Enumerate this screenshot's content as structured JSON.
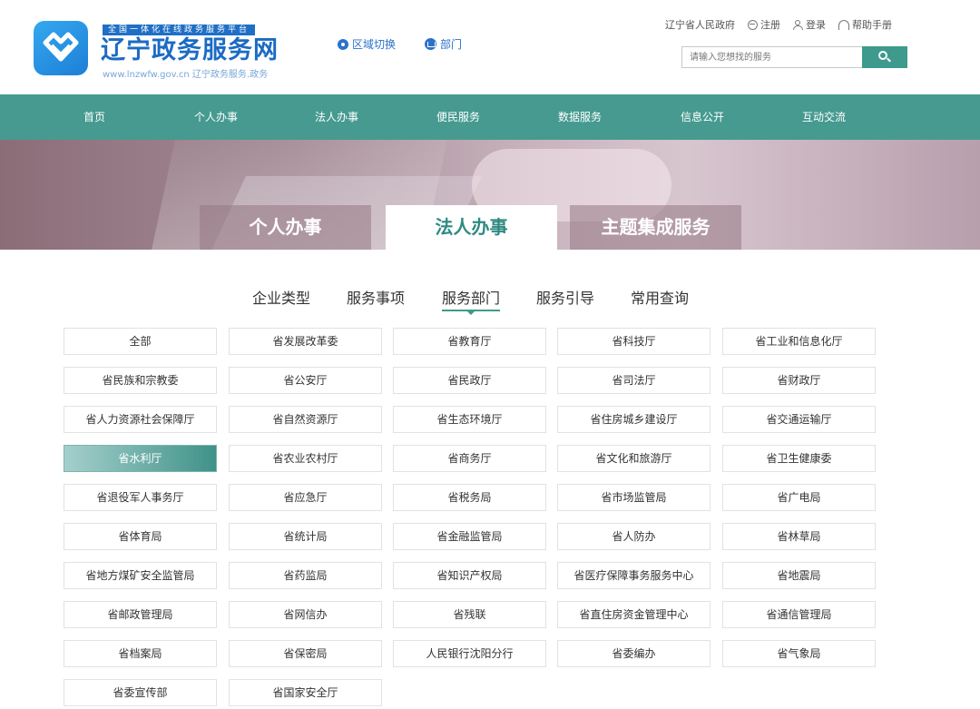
{
  "header": {
    "logo_band": "全国一体化在线政务服务平台",
    "logo_title": "辽宁政务服务网",
    "logo_url": "www.lnzwfw.gov.cn 辽宁政务服务.政务",
    "region_switch": "区域切换",
    "department": "部门",
    "top_links": {
      "gov": "辽宁省人民政府",
      "register": "注册",
      "login": "登录",
      "help": "帮助手册"
    },
    "search": {
      "placeholder": "请输入您想找的服务"
    }
  },
  "nav": [
    "首页",
    "个人办事",
    "法人办事",
    "便民服务",
    "数据服务",
    "信息公开",
    "互动交流"
  ],
  "banner_tabs": [
    {
      "label": "个人办事",
      "active": false
    },
    {
      "label": "法人办事",
      "active": true
    },
    {
      "label": "主题集成服务",
      "active": false
    }
  ],
  "sub_tabs": [
    {
      "label": "企业类型",
      "active": false
    },
    {
      "label": "服务事项",
      "active": false
    },
    {
      "label": "服务部门",
      "active": true
    },
    {
      "label": "服务引导",
      "active": false
    },
    {
      "label": "常用查询",
      "active": false
    }
  ],
  "departments": [
    "全部",
    "省发展改革委",
    "省教育厅",
    "省科技厅",
    "省工业和信息化厅",
    "省民族和宗教委",
    "省公安厅",
    "省民政厅",
    "省司法厅",
    "省财政厅",
    "省人力资源社会保障厅",
    "省自然资源厅",
    "省生态环境厅",
    "省住房城乡建设厅",
    "省交通运输厅",
    "省水利厅",
    "省农业农村厅",
    "省商务厅",
    "省文化和旅游厅",
    "省卫生健康委",
    "省退役军人事务厅",
    "省应急厅",
    "省税务局",
    "省市场监管局",
    "省广电局",
    "省体育局",
    "省统计局",
    "省金融监管局",
    "省人防办",
    "省林草局",
    "省地方煤矿安全监管局",
    "省药监局",
    "省知识产权局",
    "省医疗保障事务服务中心",
    "省地震局",
    "省邮政管理局",
    "省网信办",
    "省残联",
    "省直住房资金管理中心",
    "省通信管理局",
    "省档案局",
    "省保密局",
    "人民银行沈阳分行",
    "省委编办",
    "省气象局",
    "省委宣传部",
    "省国家安全厅"
  ],
  "active_department": "省水利厅",
  "colors": {
    "brand_blue": "#1b6bc4",
    "nav_teal": "#469a90",
    "accent_teal": "#3d9a8d"
  }
}
